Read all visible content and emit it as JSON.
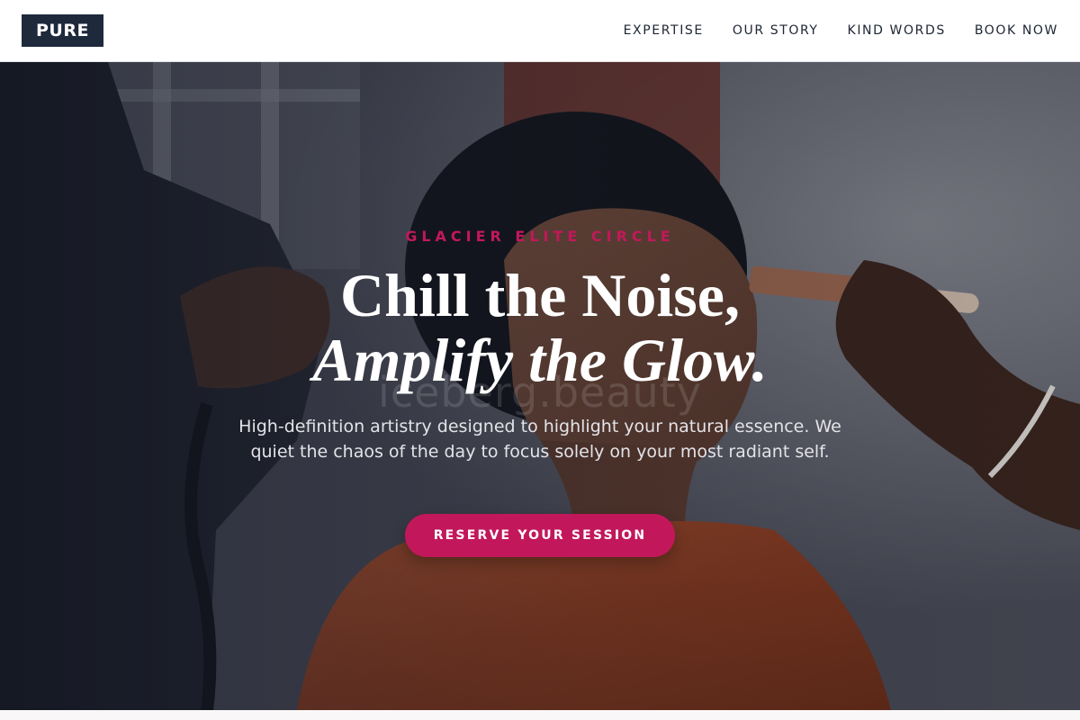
{
  "brand": {
    "logo_text": "PURE"
  },
  "nav": {
    "items": [
      {
        "label": "EXPERTISE"
      },
      {
        "label": "OUR STORY"
      },
      {
        "label": "KIND WORDS"
      },
      {
        "label": "BOOK NOW"
      }
    ]
  },
  "hero": {
    "eyebrow": "GLACIER ELITE CIRCLE",
    "headline_line1": "Chill the Noise,",
    "headline_line2": "Amplify the Glow.",
    "watermark": "iceberg.beauty",
    "subtext": "High-definition artistry designed to highlight your natural essence. We quiet the chaos of the day to focus solely on your most radiant self.",
    "cta_label": "RESERVE YOUR SESSION",
    "photo_alt": "Makeup artist applying a brush to a woman's face"
  },
  "colors": {
    "accent": "#c2185b",
    "logo_bg": "#1e293b",
    "nav_text": "#1e2533"
  }
}
